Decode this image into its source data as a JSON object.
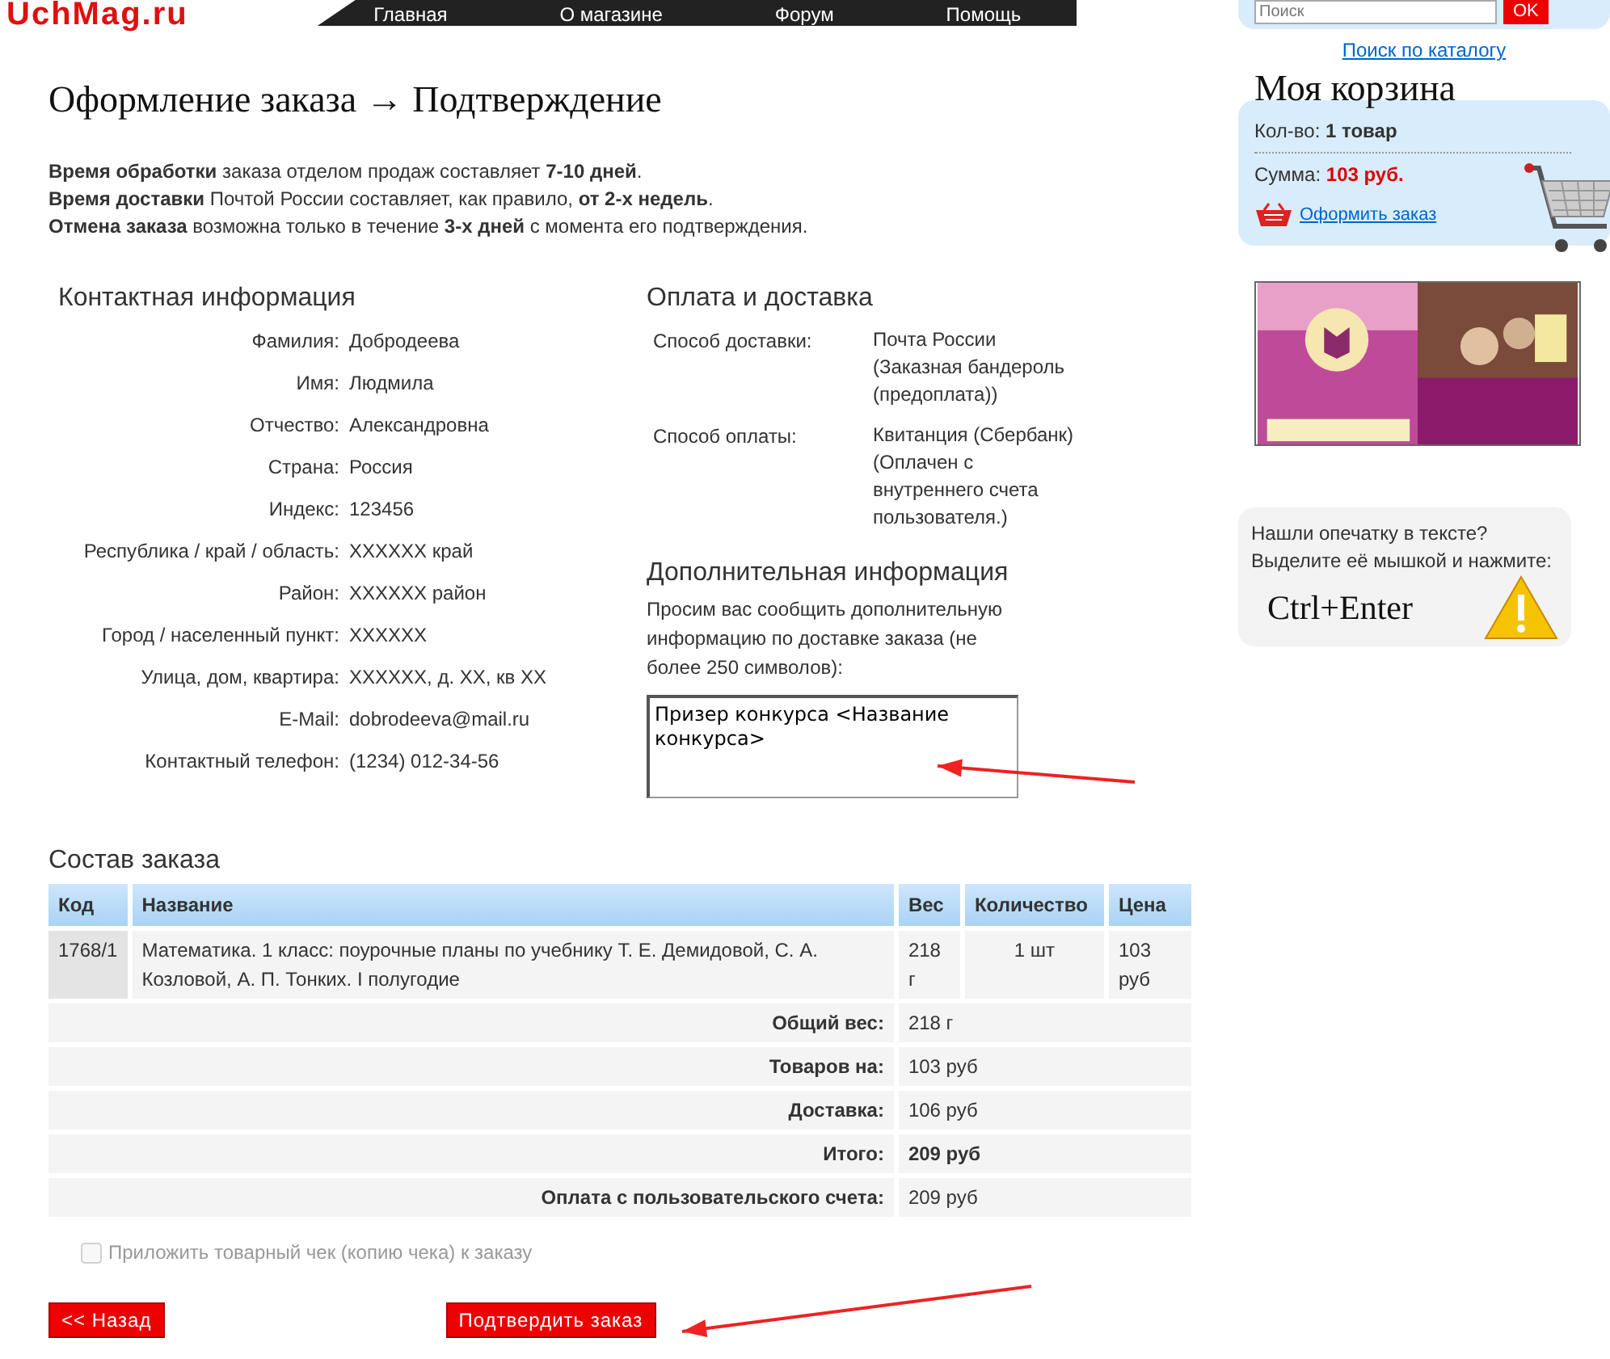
{
  "header": {
    "logo": "UchMag.ru",
    "nav": [
      "Главная",
      "О магазине",
      "Форум",
      "Помощь"
    ]
  },
  "title": "Оформление заказа → Подтверждение",
  "intro": [
    "**Время обработки** заказа отделом продаж составляет **7-10 дней**.",
    "**Время доставки** Почтой России составляет, как правило, **от 2-х недель**.",
    "**Отмена заказа** возможна только в течение **3-х дней** с момента его подтверждения."
  ],
  "contact": {
    "heading": "Контактная информация",
    "fields": [
      {
        "label": "Фамилия:",
        "value": "Добродеева"
      },
      {
        "label": "Имя:",
        "value": "Людмила"
      },
      {
        "label": "Отчество:",
        "value": "Александровна"
      },
      {
        "label": "Страна:",
        "value": "Россия"
      },
      {
        "label": "Индекс:",
        "value": "123456"
      },
      {
        "label": "Республика / край / область:",
        "value": "XXXXXX край"
      },
      {
        "label": "Район:",
        "value": "XXXXXX район"
      },
      {
        "label": "Город / населенный пункт:",
        "value": "XXXXXX"
      },
      {
        "label": "Улица, дом, квартира:",
        "value": "XXXXXX, д. XX, кв XX"
      },
      {
        "label": "E-Mail:",
        "value": "dobrodeeva@mail.ru"
      },
      {
        "label": "Контактный телефон:",
        "value": "(1234) 012-34-56"
      }
    ]
  },
  "payment": {
    "heading": "Оплата и доставка",
    "fields": [
      {
        "label": "Способ доставки:",
        "value": "Почта России (Заказная бандероль (предоплата))"
      },
      {
        "label": "Способ оплаты:",
        "value": "Квитанция (Сбербанк) (Оплачен с внутреннего счета пользователя.)"
      }
    ]
  },
  "additional": {
    "heading": "Дополнительная информация",
    "text": "Просим вас сообщить дополнительную информацию по доставке заказа (не более 250 символов):",
    "value": "Призер конкурса <Название конкурса>"
  },
  "order": {
    "heading": "Состав заказа",
    "columns": [
      "Код",
      "Название",
      "Вес",
      "Количество",
      "Цена"
    ],
    "rows": [
      [
        "1768/1",
        "Математика. 1 класс: поурочные планы по учебнику Т. Е. Демидовой, С. А. Козловой, А. П. Тонких. I полугодие",
        "218 г",
        "1 шт",
        "103 руб"
      ]
    ],
    "totals": [
      {
        "label": "Общий вес:",
        "value": "218 г",
        "bold": false
      },
      {
        "label": "Товаров на:",
        "value": "103 руб",
        "bold": false
      },
      {
        "label": "Доставка:",
        "value": "106 руб",
        "bold": false
      },
      {
        "label": "Итого:",
        "value": "209 руб",
        "bold": true
      },
      {
        "label": "Оплата с пользовательского счета:",
        "value": "209 руб",
        "bold": false
      }
    ]
  },
  "receipt": {
    "label": "Приложить товарный чек (копию чека) к заказу",
    "checked": false,
    "disabled": true
  },
  "buttons": {
    "back": "<< Назад",
    "confirm": "Подтвердить заказ"
  },
  "sidebar": {
    "search": {
      "placeholder": "Поиск",
      "button": "OK",
      "link": "Поиск по каталогу"
    },
    "cart": {
      "title": "Моя корзина",
      "count_label": "Кол-во:",
      "count": "1 товар",
      "sum_label": "Сумма:",
      "sum": "103 руб.",
      "link": "Оформить заказ"
    },
    "typo": {
      "text": "Нашли опечатку в тексте? Выделите её мышкой и нажмите:",
      "keys": "Ctrl+Enter"
    }
  }
}
